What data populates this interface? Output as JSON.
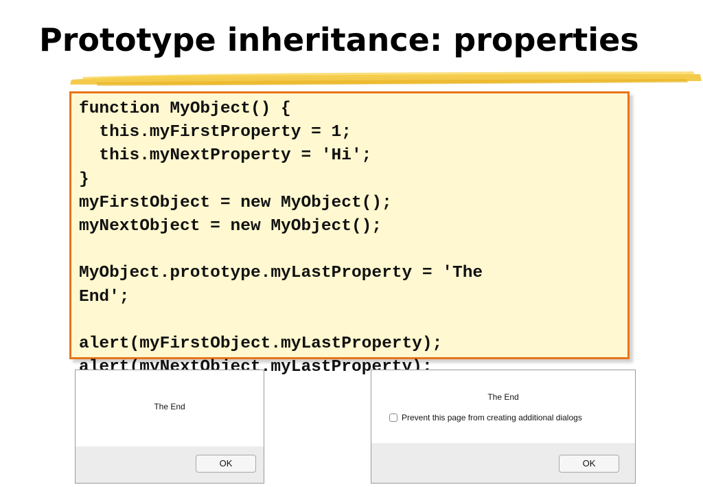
{
  "slide": {
    "title": "Prototype inheritance: properties"
  },
  "code": {
    "lines": [
      "function MyObject() {",
      "  this.myFirstProperty = 1;",
      "  this.myNextProperty = 'Hi';",
      "}",
      "myFirstObject = new MyObject();",
      "myNextObject = new MyObject();",
      "",
      "MyObject.prototype.myLastProperty = 'The",
      "End';",
      "",
      "alert(myFirstObject.myLastProperty);",
      "alert(myNextObject.myLastProperty);"
    ]
  },
  "dialogs": {
    "first": {
      "message": "The End",
      "ok_label": "OK"
    },
    "second": {
      "message": "The End",
      "checkbox_label": "Prevent this page from creating additional dialogs",
      "ok_label": "OK"
    }
  },
  "colors": {
    "code_background": "#fff8d0",
    "code_border": "#e8741a",
    "highlighter_stroke": "#f2c12e"
  }
}
